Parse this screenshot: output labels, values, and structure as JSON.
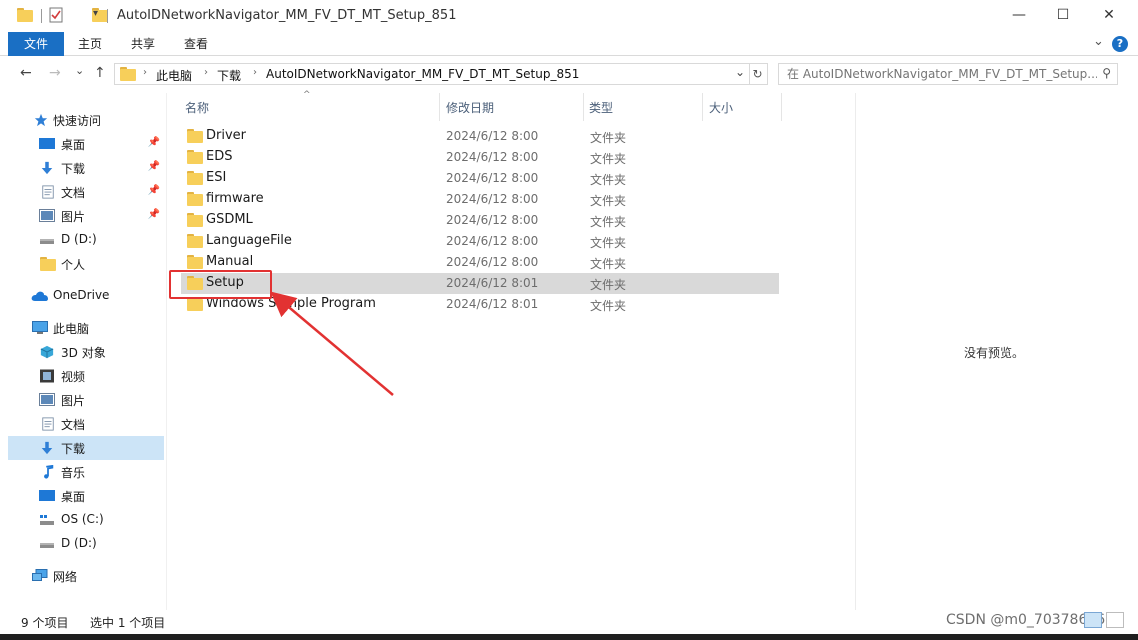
{
  "window": {
    "title": "AutoIDNetworkNavigator_MM_FV_DT_MT_Setup_851",
    "minimize_glyph": "—",
    "maximize_glyph": "☐",
    "close_glyph": "✕"
  },
  "ribbon": {
    "tabs": [
      "文件",
      "主页",
      "共享",
      "查看"
    ],
    "help_glyph": "?",
    "expand_glyph": "⌄"
  },
  "address": {
    "back_glyph": "←",
    "forward_glyph": "→",
    "recent_glyph": "⌄",
    "up_glyph": "↑",
    "breadcrumb": [
      "此电脑",
      "下载",
      "AutoIDNetworkNavigator_MM_FV_DT_MT_Setup_851"
    ],
    "separator": "›",
    "dropdown_glyph": "⌄",
    "refresh_glyph": "↻",
    "search_placeholder": "在 AutoIDNetworkNavigator_MM_FV_DT_MT_Setup...",
    "search_glyph": "⚲"
  },
  "sidebar": {
    "pin_glyph": "📌",
    "quick_access": {
      "label": "快速访问",
      "icon": "star-icon"
    },
    "quick_items": [
      {
        "label": "桌面",
        "icon": "desktop-icon",
        "pinned": true
      },
      {
        "label": "下载",
        "icon": "download-icon",
        "pinned": true
      },
      {
        "label": "文档",
        "icon": "document-icon",
        "pinned": true
      },
      {
        "label": "图片",
        "icon": "pictures-icon",
        "pinned": true
      },
      {
        "label": "D (D:)",
        "icon": "drive-icon",
        "pinned": false
      },
      {
        "label": "个人",
        "icon": "folder-icon",
        "pinned": false
      }
    ],
    "onedrive": {
      "label": "OneDrive",
      "icon": "cloud-icon"
    },
    "this_pc": {
      "label": "此电脑",
      "icon": "computer-icon"
    },
    "pc_items": [
      {
        "label": "3D 对象",
        "icon": "3d-objects-icon"
      },
      {
        "label": "视频",
        "icon": "video-icon"
      },
      {
        "label": "图片",
        "icon": "pictures-icon"
      },
      {
        "label": "文档",
        "icon": "document-icon"
      },
      {
        "label": "下载",
        "icon": "download-icon",
        "selected": true
      },
      {
        "label": "音乐",
        "icon": "music-icon"
      },
      {
        "label": "桌面",
        "icon": "desktop-icon"
      },
      {
        "label": "OS (C:)",
        "icon": "drive-icon"
      },
      {
        "label": "D (D:)",
        "icon": "drive-icon"
      }
    ],
    "network": {
      "label": "网络",
      "icon": "network-icon"
    }
  },
  "columns": {
    "name": "名称",
    "modified": "修改日期",
    "type": "类型",
    "size": "大小",
    "sort_glyph": "^"
  },
  "files": [
    {
      "name": "Driver",
      "modified": "2024/6/12 8:00",
      "type": "文件夹"
    },
    {
      "name": "EDS",
      "modified": "2024/6/12 8:00",
      "type": "文件夹"
    },
    {
      "name": "ESI",
      "modified": "2024/6/12 8:00",
      "type": "文件夹"
    },
    {
      "name": "firmware",
      "modified": "2024/6/12 8:00",
      "type": "文件夹"
    },
    {
      "name": "GSDML",
      "modified": "2024/6/12 8:00",
      "type": "文件夹"
    },
    {
      "name": "LanguageFile",
      "modified": "2024/6/12 8:00",
      "type": "文件夹"
    },
    {
      "name": "Manual",
      "modified": "2024/6/12 8:00",
      "type": "文件夹"
    },
    {
      "name": "Setup",
      "modified": "2024/6/12 8:01",
      "type": "文件夹",
      "selected": true
    },
    {
      "name": "Windows Sample Program",
      "modified": "2024/6/12 8:01",
      "type": "文件夹"
    }
  ],
  "preview": {
    "text": "没有预览。"
  },
  "status": {
    "count": "9 个项目",
    "selected": "选中 1 个项目"
  },
  "watermark": "CSDN @m0_70378696",
  "colors": {
    "accent": "#1a6fc4",
    "selection": "#d9d9d9",
    "sidebar_selection": "#cce4f7",
    "annotation": "#e23232"
  }
}
